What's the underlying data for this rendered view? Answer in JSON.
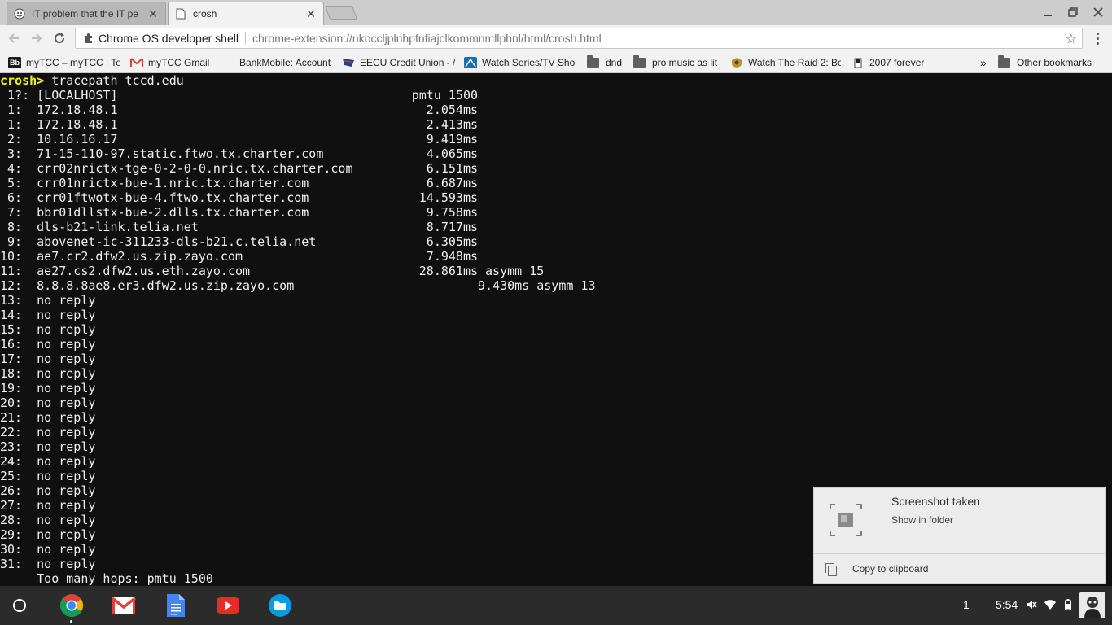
{
  "tabs": [
    {
      "title": "IT problem that the IT pe",
      "active": false
    },
    {
      "title": "crosh",
      "active": true
    }
  ],
  "toolbar": {
    "site_name": "Chrome OS developer shell",
    "url": "chrome-extension://nkoccljplnhpfnfiajclkommnmllphnl/html/crosh.html"
  },
  "bookmarks": [
    {
      "label": "myTCC – myTCC | Te",
      "icon": "bb-icon",
      "color": "#1a1a1a"
    },
    {
      "label": "myTCC Gmail",
      "icon": "gmail-icon",
      "color": "#d44638"
    },
    {
      "label": "BankMobile: Account",
      "icon": "blank-icon",
      "color": ""
    },
    {
      "label": "EECU Credit Union - /",
      "icon": "eecu-icon",
      "color": "#263d8a"
    },
    {
      "label": "Watch Series/TV Sho",
      "icon": "watch-series-icon",
      "color": "#1b6eb3"
    },
    {
      "label": "dnd",
      "icon": "folder-icon",
      "color": "#5f5f5f"
    },
    {
      "label": "pro music as lit",
      "icon": "folder-icon",
      "color": "#5f5f5f"
    },
    {
      "label": "Watch The Raid 2: Be",
      "icon": "badge-icon",
      "color": "#b8962e"
    },
    {
      "label": "2007 forever",
      "icon": "page-icon",
      "color": "#222222"
    }
  ],
  "bookmarks_overflow": "»",
  "other_bookmarks": "Other bookmarks",
  "terminal": {
    "prompt": "crosh>",
    "command": " tracepath tccd.edu",
    "lines": [
      " 1?: [LOCALHOST]                                        pmtu 1500",
      " 1:  172.18.48.1                                          2.054ms",
      " 1:  172.18.48.1                                          2.413ms",
      " 2:  10.16.16.17                                          9.419ms",
      " 3:  71-15-110-97.static.ftwo.tx.charter.com              4.065ms",
      " 4:  crr02nrictx-tge-0-2-0-0.nric.tx.charter.com          6.151ms",
      " 5:  crr01nrictx-bue-1.nric.tx.charter.com                6.687ms",
      " 6:  crr01ftwotx-bue-4.ftwo.tx.charter.com               14.593ms",
      " 7:  bbr01dllstx-bue-2.dlls.tx.charter.com                9.758ms",
      " 8:  dls-b21-link.telia.net                               8.717ms",
      " 9:  abovenet-ic-311233-dls-b21.c.telia.net               6.305ms",
      "10:  ae7.cr2.dfw2.us.zip.zayo.com                         7.948ms",
      "11:  ae27.cs2.dfw2.us.eth.zayo.com                       28.861ms asymm 15",
      "12:  8.8.8.8ae8.er3.dfw2.us.zip.zayo.com                         9.430ms asymm 13",
      "13:  no reply",
      "14:  no reply",
      "15:  no reply",
      "16:  no reply",
      "17:  no reply",
      "18:  no reply",
      "19:  no reply",
      "20:  no reply",
      "21:  no reply",
      "22:  no reply",
      "23:  no reply",
      "24:  no reply",
      "25:  no reply",
      "26:  no reply",
      "27:  no reply",
      "28:  no reply",
      "29:  no reply",
      "30:  no reply",
      "31:  no reply",
      "     Too many hops: pmtu 1500"
    ]
  },
  "notification": {
    "title": "Screenshot taken",
    "link": "Show in folder",
    "action": "Copy to clipboard"
  },
  "shelf": {
    "apps": [
      "chrome-icon",
      "gmail-icon",
      "docs-icon",
      "youtube-icon",
      "files-icon"
    ],
    "tray_count": "1",
    "time": "5:54"
  },
  "colors": {
    "prompt": "#f4f400",
    "terminal_bg": "#101010",
    "terminal_fg": "#f0f0f0"
  }
}
